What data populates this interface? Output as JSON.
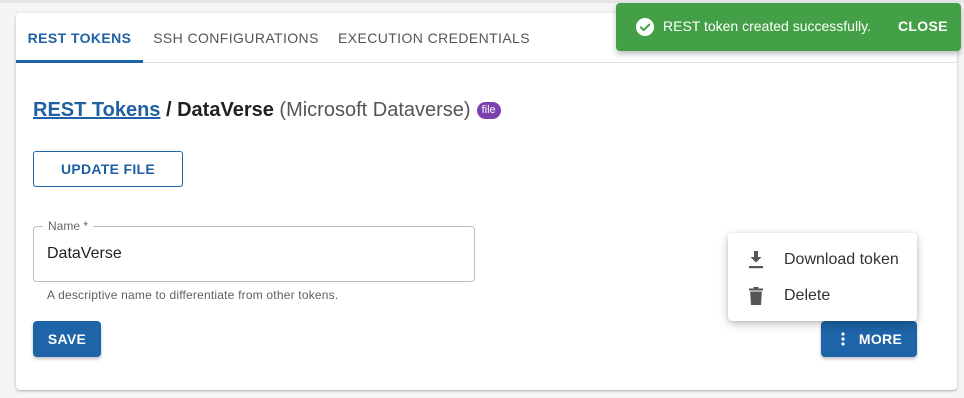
{
  "tabs": [
    {
      "label": "REST TOKENS",
      "active": true
    },
    {
      "label": "SSH CONFIGURATIONS",
      "active": false
    },
    {
      "label": "EXECUTION CREDENTIALS",
      "active": false
    }
  ],
  "breadcrumb": {
    "parent_link": "REST Tokens",
    "separator": " / ",
    "current": "DataVerse",
    "subtitle": "(Microsoft Dataverse)",
    "badge": "file"
  },
  "actions": {
    "update_file_label": "UPDATE FILE",
    "save_label": "SAVE",
    "more_label": "MORE"
  },
  "form": {
    "name_label": "Name *",
    "name_value": "DataVerse",
    "name_helper": "A descriptive name to differentiate from other tokens."
  },
  "more_menu": {
    "items": [
      {
        "label": "Download token",
        "icon": "download-icon"
      },
      {
        "label": "Delete",
        "icon": "trash-icon"
      }
    ]
  },
  "toast": {
    "message": "REST token created successfully.",
    "close_label": "CLOSE",
    "icon": "check-circle-icon"
  },
  "colors": {
    "primary": "#1e64a8",
    "success": "#43a047",
    "badge": "#7b3fae"
  }
}
